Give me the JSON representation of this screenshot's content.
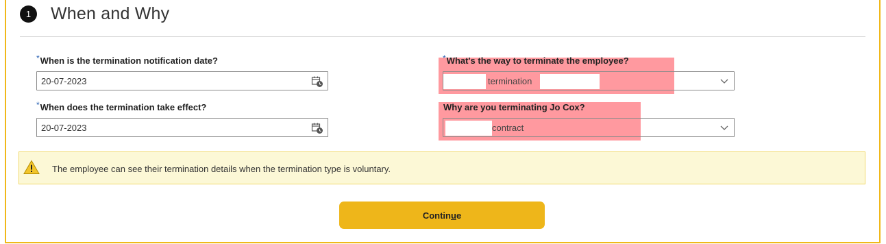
{
  "section": {
    "step_number": "1",
    "title": "When and Why"
  },
  "fields": {
    "notification_date": {
      "required_mark": "*",
      "label": "When is the termination notification date?",
      "value": "20-07-2023"
    },
    "effective_date": {
      "required_mark": "*",
      "label": "When does the termination take effect?",
      "value": "20-07-2023"
    },
    "termination_way": {
      "required_mark": "*",
      "label": "What's the way to terminate the employee?",
      "value": "termination"
    },
    "termination_reason": {
      "label": "Why are you terminating Jo Cox?",
      "value": "contract"
    }
  },
  "warning": {
    "text": "The employee can see their termination details when the termination type is voluntary."
  },
  "continue_button": {
    "label_before": "Contin",
    "label_accel": "u",
    "label_after": "e"
  },
  "colors": {
    "accent": "#eeb61a",
    "warning_bg": "#fcf8d6",
    "highlight": "#ff3c46",
    "required_mark": "#2b63b5"
  },
  "icons": {
    "calendar": "calendar-icon",
    "chevron": "chevron-down-icon",
    "warning": "warning-icon"
  }
}
